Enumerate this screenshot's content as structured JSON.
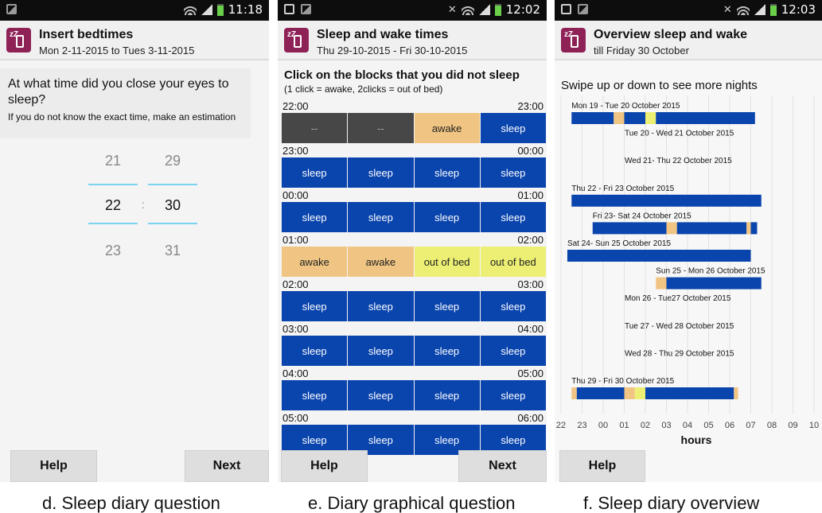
{
  "panel_d": {
    "time": "11:18",
    "title": "Insert bedtimes",
    "subtitle": "Mon 2-11-2015 to Tues 3-11-2015",
    "question": "At what time did you close your eyes to sleep?",
    "hint": "If you do not know the exact time, make an estimation",
    "hours": {
      "prev": "21",
      "selected": "22",
      "next": "23"
    },
    "minutes": {
      "prev": "29",
      "selected": "30",
      "next": "31"
    },
    "separator": ":",
    "help_label": "Help",
    "next_label": "Next",
    "caption": "d. Sleep diary question"
  },
  "panel_e": {
    "time": "12:02",
    "title": "Sleep and wake times",
    "subtitle": "Thu 29-10-2015 - Fri 30-10-2015",
    "instruction": "Click on the blocks that you did not sleep",
    "instruction_detail": "(1 click = awake, 2clicks = out of bed)",
    "rows": [
      {
        "start": "22:00",
        "end": "23:00",
        "blocks": [
          "--",
          "--",
          "awake",
          "sleep"
        ]
      },
      {
        "start": "23:00",
        "end": "00:00",
        "blocks": [
          "sleep",
          "sleep",
          "sleep",
          "sleep"
        ]
      },
      {
        "start": "00:00",
        "end": "01:00",
        "blocks": [
          "sleep",
          "sleep",
          "sleep",
          "sleep"
        ]
      },
      {
        "start": "01:00",
        "end": "02:00",
        "blocks": [
          "awake",
          "awake",
          "out of bed",
          "out of bed"
        ]
      },
      {
        "start": "02:00",
        "end": "03:00",
        "blocks": [
          "sleep",
          "sleep",
          "sleep",
          "sleep"
        ]
      },
      {
        "start": "03:00",
        "end": "04:00",
        "blocks": [
          "sleep",
          "sleep",
          "sleep",
          "sleep"
        ]
      },
      {
        "start": "04:00",
        "end": "05:00",
        "blocks": [
          "sleep",
          "sleep",
          "sleep",
          "sleep"
        ]
      },
      {
        "start": "05:00",
        "end": "06:00",
        "blocks": [
          "sleep",
          "sleep",
          "sleep",
          "sleep"
        ]
      }
    ],
    "help_label": "Help",
    "next_label": "Next",
    "caption": "e. Diary graphical question"
  },
  "panel_f": {
    "time": "12:03",
    "title": "Overview sleep and wake",
    "subtitle": "till Friday 30 October",
    "swipe_hint": "Swipe up or down to see more nights",
    "help_label": "Help",
    "caption": "f. Sleep diary overview"
  },
  "colors": {
    "sleep": "#0a44ad",
    "awake": "#f0c583",
    "out_of_bed": "#ecef73",
    "no_data": "#474747",
    "brand": "#8e2257"
  },
  "chart_data": {
    "type": "bar",
    "xlabel": "hours",
    "ticks": [
      "22",
      "23",
      "00",
      "01",
      "02",
      "03",
      "04",
      "05",
      "06",
      "07",
      "08",
      "09",
      "10"
    ],
    "xlim": [
      22,
      34
    ],
    "grid": true,
    "nights": [
      {
        "label": "Mon 19 - Tue 20 October 2015",
        "segments": [
          {
            "start": 22.5,
            "end": 24.5,
            "state": "sleep"
          },
          {
            "start": 24.5,
            "end": 25.0,
            "state": "awake"
          },
          {
            "start": 25.0,
            "end": 26.0,
            "state": "sleep"
          },
          {
            "start": 26.0,
            "end": 26.5,
            "state": "out_of_bed"
          },
          {
            "start": 26.5,
            "end": 31.2,
            "state": "sleep"
          }
        ]
      },
      {
        "label": "Tue 20 - Wed 21 October 2015",
        "segments": []
      },
      {
        "label": "Wed 21- Thu 22 October 2015",
        "segments": []
      },
      {
        "label": "Thu 22 - Fri 23 October 2015",
        "segments": [
          {
            "start": 22.5,
            "end": 31.5,
            "state": "sleep"
          }
        ]
      },
      {
        "label": "Fri 23- Sat 24 October 2015",
        "segments": [
          {
            "start": 23.5,
            "end": 27.0,
            "state": "sleep"
          },
          {
            "start": 27.0,
            "end": 27.5,
            "state": "awake"
          },
          {
            "start": 27.5,
            "end": 30.8,
            "state": "sleep"
          },
          {
            "start": 30.8,
            "end": 31.0,
            "state": "awake"
          },
          {
            "start": 31.0,
            "end": 31.3,
            "state": "sleep"
          }
        ]
      },
      {
        "label": "Sat 24- Sun 25 October 2015",
        "segments": [
          {
            "start": 22.3,
            "end": 31.0,
            "state": "sleep"
          }
        ]
      },
      {
        "label": "Sun 25 - Mon 26 October 2015",
        "segments": [
          {
            "start": 26.5,
            "end": 27.0,
            "state": "awake"
          },
          {
            "start": 27.0,
            "end": 31.5,
            "state": "sleep"
          }
        ]
      },
      {
        "label": "Mon 26 - Tue27 October 2015",
        "segments": []
      },
      {
        "label": "Tue 27 - Wed 28 October 2015",
        "segments": []
      },
      {
        "label": "Wed 28 - Thu 29 October 2015",
        "segments": []
      },
      {
        "label": "Thu 29 - Fri 30 October 2015",
        "segments": [
          {
            "start": 22.5,
            "end": 22.75,
            "state": "awake"
          },
          {
            "start": 22.75,
            "end": 25.0,
            "state": "sleep"
          },
          {
            "start": 25.0,
            "end": 25.5,
            "state": "awake"
          },
          {
            "start": 25.5,
            "end": 26.0,
            "state": "out_of_bed"
          },
          {
            "start": 26.0,
            "end": 30.2,
            "state": "sleep"
          },
          {
            "start": 30.2,
            "end": 30.4,
            "state": "awake"
          }
        ]
      }
    ]
  }
}
